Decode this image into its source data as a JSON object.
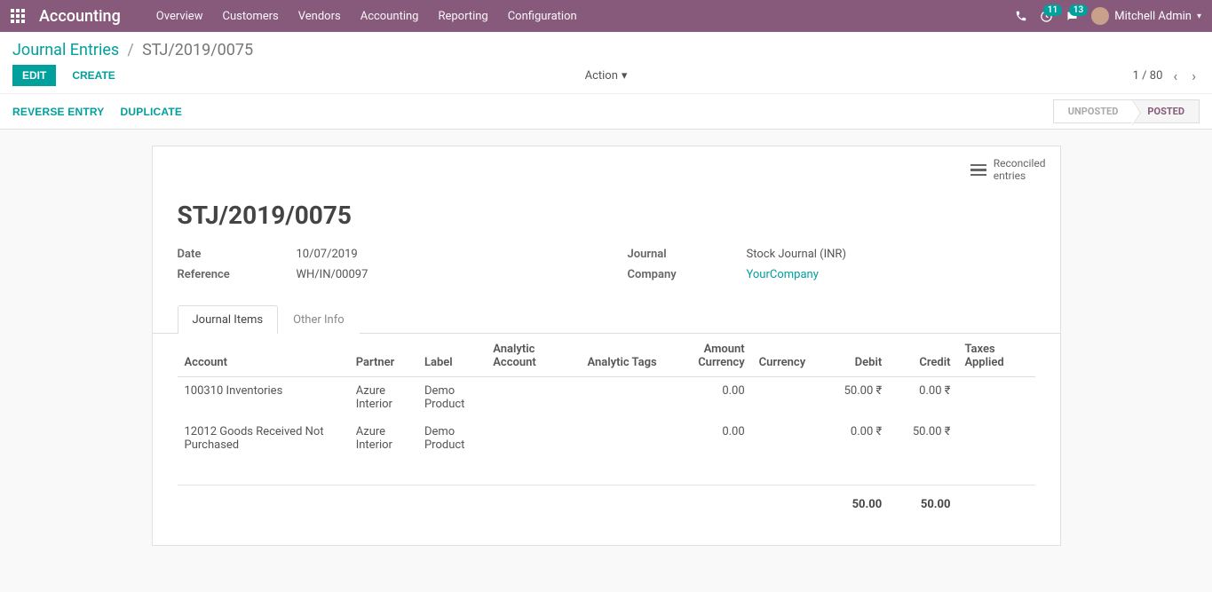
{
  "navbar": {
    "brand": "Accounting",
    "items": [
      "Overview",
      "Customers",
      "Vendors",
      "Accounting",
      "Reporting",
      "Configuration"
    ],
    "activity_badge": "11",
    "chat_badge": "13",
    "user_name": "Mitchell Admin"
  },
  "breadcrumb": {
    "root": "Journal Entries",
    "current": "STJ/2019/0075"
  },
  "buttons": {
    "edit": "EDIT",
    "create": "CREATE",
    "action": "Action",
    "reverse": "REVERSE ENTRY",
    "duplicate": "DUPLICATE"
  },
  "pager": {
    "text": "1 / 80"
  },
  "status": {
    "unposted": "UNPOSTED",
    "posted": "POSTED"
  },
  "stat_button": {
    "label_line1": "Reconciled",
    "label_line2": "entries"
  },
  "record": {
    "name": "STJ/2019/0075",
    "fields_left": [
      {
        "label": "Date",
        "value": "10/07/2019"
      },
      {
        "label": "Reference",
        "value": "WH/IN/00097"
      }
    ],
    "fields_right": [
      {
        "label": "Journal",
        "value": "Stock Journal (INR)"
      },
      {
        "label": "Company",
        "value": "YourCompany",
        "link": true
      }
    ]
  },
  "tabs": {
    "items": [
      "Journal Items",
      "Other Info"
    ],
    "active": 0
  },
  "table": {
    "headers": [
      "Account",
      "Partner",
      "Label",
      "Analytic Account",
      "Analytic Tags",
      "Amount Currency",
      "Currency",
      "Debit",
      "Credit",
      "Taxes Applied"
    ],
    "rows": [
      {
        "account": "100310 Inventories",
        "partner": "Azure Interior",
        "label": "Demo Product",
        "analytic_account": "",
        "analytic_tags": "",
        "amount_currency": "0.00",
        "currency": "",
        "debit": "50.00 ₹",
        "credit": "0.00 ₹",
        "taxes": ""
      },
      {
        "account": "12012 Goods Received Not Purchased",
        "partner": "Azure Interior",
        "label": "Demo Product",
        "analytic_account": "",
        "analytic_tags": "",
        "amount_currency": "0.00",
        "currency": "",
        "debit": "0.00 ₹",
        "credit": "50.00 ₹",
        "taxes": ""
      }
    ],
    "totals": {
      "debit": "50.00",
      "credit": "50.00"
    }
  }
}
